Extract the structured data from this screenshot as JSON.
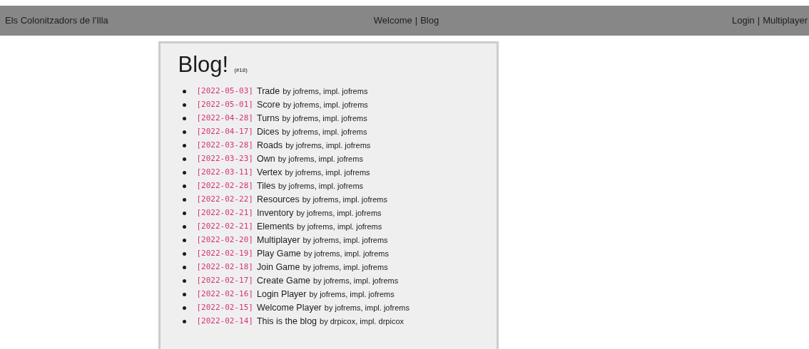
{
  "header": {
    "brand": "Els Colonitzadors de l'Illa",
    "center_links": [
      "Welcome",
      "Blog"
    ],
    "right_links": [
      "Login",
      "Multiplayer"
    ],
    "separator": "|"
  },
  "blog": {
    "title": "Blog!",
    "count": "(#18)",
    "posts": [
      {
        "date": "[2022-05-03]",
        "title": "Trade",
        "byline": "by jofrems, impl. jofrems"
      },
      {
        "date": "[2022-05-01]",
        "title": "Score",
        "byline": "by jofrems, impl. jofrems"
      },
      {
        "date": "[2022-04-28]",
        "title": "Turns",
        "byline": "by jofrems, impl. jofrems"
      },
      {
        "date": "[2022-04-17]",
        "title": "Dices",
        "byline": "by jofrems, impl. jofrems"
      },
      {
        "date": "[2022-03-28]",
        "title": "Roads",
        "byline": "by jofrems, impl. jofrems"
      },
      {
        "date": "[2022-03-23]",
        "title": "Own",
        "byline": "by jofrems, impl. jofrems"
      },
      {
        "date": "[2022-03-11]",
        "title": "Vertex",
        "byline": "by jofrems, impl. jofrems"
      },
      {
        "date": "[2022-02-28]",
        "title": "Tiles",
        "byline": "by jofrems, impl. jofrems"
      },
      {
        "date": "[2022-02-22]",
        "title": "Resources",
        "byline": "by jofrems, impl. jofrems"
      },
      {
        "date": "[2022-02-21]",
        "title": "Inventory",
        "byline": "by jofrems, impl. jofrems"
      },
      {
        "date": "[2022-02-21]",
        "title": "Elements",
        "byline": "by jofrems, impl. jofrems"
      },
      {
        "date": "[2022-02-20]",
        "title": "Multiplayer",
        "byline": "by jofrems, impl. jofrems"
      },
      {
        "date": "[2022-02-19]",
        "title": "Play Game",
        "byline": "by jofrems, impl. jofrems"
      },
      {
        "date": "[2022-02-18]",
        "title": "Join Game",
        "byline": "by jofrems, impl. jofrems"
      },
      {
        "date": "[2022-02-17]",
        "title": "Create Game",
        "byline": "by jofrems, impl. jofrems"
      },
      {
        "date": "[2022-02-16]",
        "title": "Login Player",
        "byline": "by jofrems, impl. jofrems"
      },
      {
        "date": "[2022-02-15]",
        "title": "Welcome Player",
        "byline": "by jofrems, impl. jofrems"
      },
      {
        "date": "[2022-02-14]",
        "title": "This is the blog",
        "byline": "by drpicox, impl. drpicox"
      }
    ]
  }
}
